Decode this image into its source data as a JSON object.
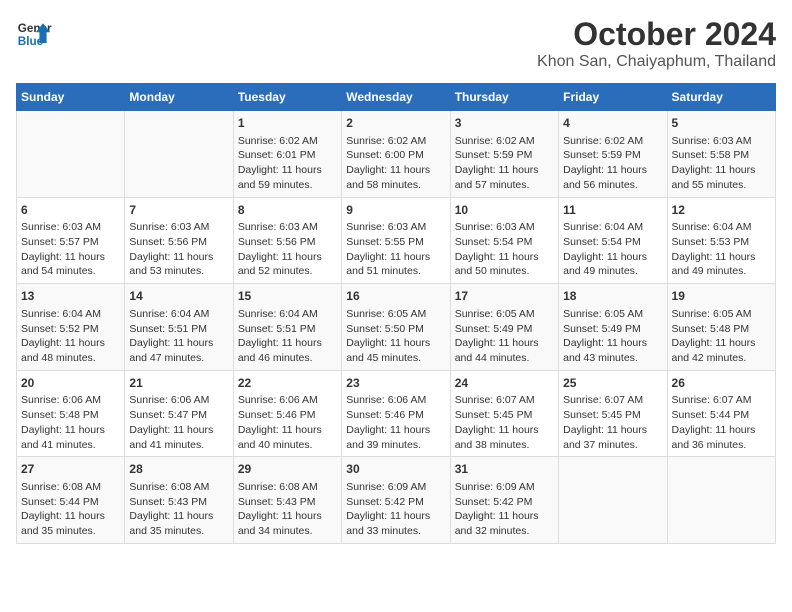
{
  "logo": {
    "line1": "General",
    "line2": "Blue"
  },
  "title": "October 2024",
  "subtitle": "Khon San, Chaiyaphum, Thailand",
  "days_of_week": [
    "Sunday",
    "Monday",
    "Tuesday",
    "Wednesday",
    "Thursday",
    "Friday",
    "Saturday"
  ],
  "weeks": [
    [
      {
        "day": "",
        "content": ""
      },
      {
        "day": "",
        "content": ""
      },
      {
        "day": "1",
        "content": "Sunrise: 6:02 AM\nSunset: 6:01 PM\nDaylight: 11 hours and 59 minutes."
      },
      {
        "day": "2",
        "content": "Sunrise: 6:02 AM\nSunset: 6:00 PM\nDaylight: 11 hours and 58 minutes."
      },
      {
        "day": "3",
        "content": "Sunrise: 6:02 AM\nSunset: 5:59 PM\nDaylight: 11 hours and 57 minutes."
      },
      {
        "day": "4",
        "content": "Sunrise: 6:02 AM\nSunset: 5:59 PM\nDaylight: 11 hours and 56 minutes."
      },
      {
        "day": "5",
        "content": "Sunrise: 6:03 AM\nSunset: 5:58 PM\nDaylight: 11 hours and 55 minutes."
      }
    ],
    [
      {
        "day": "6",
        "content": "Sunrise: 6:03 AM\nSunset: 5:57 PM\nDaylight: 11 hours and 54 minutes."
      },
      {
        "day": "7",
        "content": "Sunrise: 6:03 AM\nSunset: 5:56 PM\nDaylight: 11 hours and 53 minutes."
      },
      {
        "day": "8",
        "content": "Sunrise: 6:03 AM\nSunset: 5:56 PM\nDaylight: 11 hours and 52 minutes."
      },
      {
        "day": "9",
        "content": "Sunrise: 6:03 AM\nSunset: 5:55 PM\nDaylight: 11 hours and 51 minutes."
      },
      {
        "day": "10",
        "content": "Sunrise: 6:03 AM\nSunset: 5:54 PM\nDaylight: 11 hours and 50 minutes."
      },
      {
        "day": "11",
        "content": "Sunrise: 6:04 AM\nSunset: 5:54 PM\nDaylight: 11 hours and 49 minutes."
      },
      {
        "day": "12",
        "content": "Sunrise: 6:04 AM\nSunset: 5:53 PM\nDaylight: 11 hours and 49 minutes."
      }
    ],
    [
      {
        "day": "13",
        "content": "Sunrise: 6:04 AM\nSunset: 5:52 PM\nDaylight: 11 hours and 48 minutes."
      },
      {
        "day": "14",
        "content": "Sunrise: 6:04 AM\nSunset: 5:51 PM\nDaylight: 11 hours and 47 minutes."
      },
      {
        "day": "15",
        "content": "Sunrise: 6:04 AM\nSunset: 5:51 PM\nDaylight: 11 hours and 46 minutes."
      },
      {
        "day": "16",
        "content": "Sunrise: 6:05 AM\nSunset: 5:50 PM\nDaylight: 11 hours and 45 minutes."
      },
      {
        "day": "17",
        "content": "Sunrise: 6:05 AM\nSunset: 5:49 PM\nDaylight: 11 hours and 44 minutes."
      },
      {
        "day": "18",
        "content": "Sunrise: 6:05 AM\nSunset: 5:49 PM\nDaylight: 11 hours and 43 minutes."
      },
      {
        "day": "19",
        "content": "Sunrise: 6:05 AM\nSunset: 5:48 PM\nDaylight: 11 hours and 42 minutes."
      }
    ],
    [
      {
        "day": "20",
        "content": "Sunrise: 6:06 AM\nSunset: 5:48 PM\nDaylight: 11 hours and 41 minutes."
      },
      {
        "day": "21",
        "content": "Sunrise: 6:06 AM\nSunset: 5:47 PM\nDaylight: 11 hours and 41 minutes."
      },
      {
        "day": "22",
        "content": "Sunrise: 6:06 AM\nSunset: 5:46 PM\nDaylight: 11 hours and 40 minutes."
      },
      {
        "day": "23",
        "content": "Sunrise: 6:06 AM\nSunset: 5:46 PM\nDaylight: 11 hours and 39 minutes."
      },
      {
        "day": "24",
        "content": "Sunrise: 6:07 AM\nSunset: 5:45 PM\nDaylight: 11 hours and 38 minutes."
      },
      {
        "day": "25",
        "content": "Sunrise: 6:07 AM\nSunset: 5:45 PM\nDaylight: 11 hours and 37 minutes."
      },
      {
        "day": "26",
        "content": "Sunrise: 6:07 AM\nSunset: 5:44 PM\nDaylight: 11 hours and 36 minutes."
      }
    ],
    [
      {
        "day": "27",
        "content": "Sunrise: 6:08 AM\nSunset: 5:44 PM\nDaylight: 11 hours and 35 minutes."
      },
      {
        "day": "28",
        "content": "Sunrise: 6:08 AM\nSunset: 5:43 PM\nDaylight: 11 hours and 35 minutes."
      },
      {
        "day": "29",
        "content": "Sunrise: 6:08 AM\nSunset: 5:43 PM\nDaylight: 11 hours and 34 minutes."
      },
      {
        "day": "30",
        "content": "Sunrise: 6:09 AM\nSunset: 5:42 PM\nDaylight: 11 hours and 33 minutes."
      },
      {
        "day": "31",
        "content": "Sunrise: 6:09 AM\nSunset: 5:42 PM\nDaylight: 11 hours and 32 minutes."
      },
      {
        "day": "",
        "content": ""
      },
      {
        "day": "",
        "content": ""
      }
    ]
  ]
}
